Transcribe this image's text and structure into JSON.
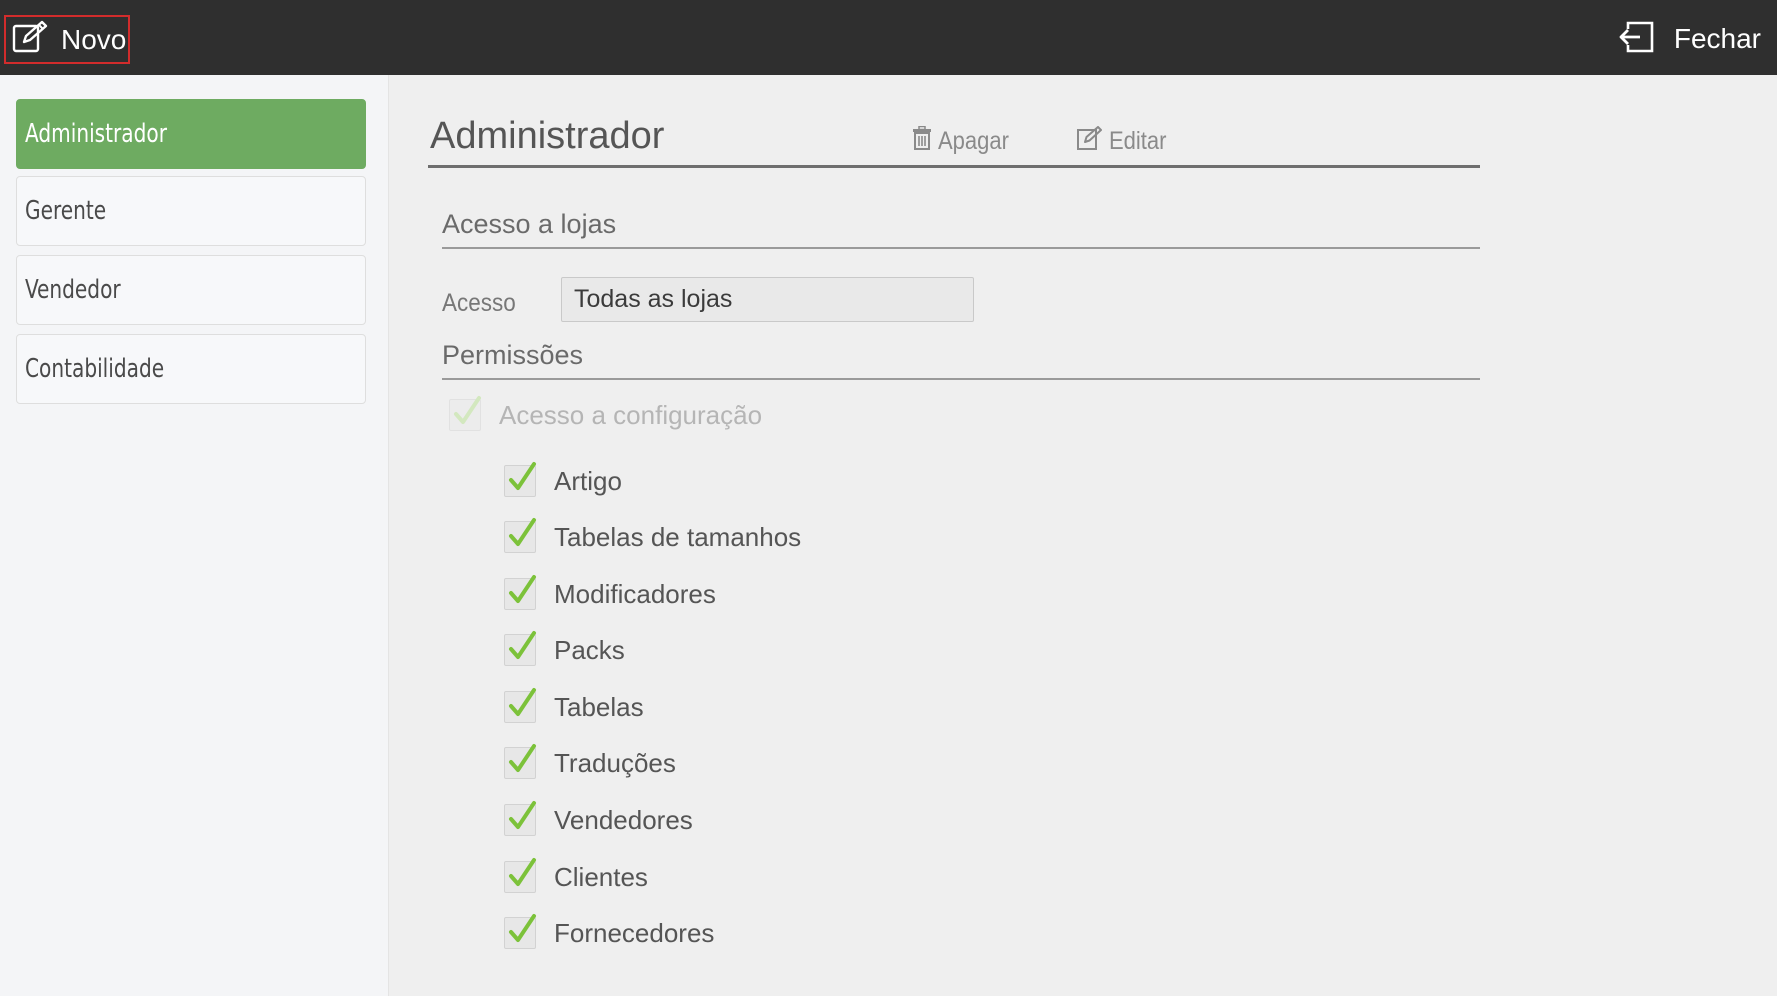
{
  "topbar": {
    "new_label": "Novo",
    "close_label": "Fechar"
  },
  "sidebar": {
    "items": [
      {
        "label": "Administrador",
        "active": true
      },
      {
        "label": "Gerente",
        "active": false
      },
      {
        "label": "Vendedor",
        "active": false
      },
      {
        "label": "Contabilidade",
        "active": false
      }
    ]
  },
  "main": {
    "title": "Administrador",
    "delete_label": "Apagar",
    "edit_label": "Editar",
    "store_access": {
      "section_title": "Acesso a lojas",
      "field_label": "Acesso",
      "value": "Todas as lojas"
    },
    "permissions": {
      "section_title": "Permissões",
      "parent": {
        "label": "Acesso a configuração",
        "checked": true,
        "disabled": true
      },
      "items": [
        {
          "label": "Artigo",
          "checked": true
        },
        {
          "label": "Tabelas de tamanhos",
          "checked": true
        },
        {
          "label": "Modificadores",
          "checked": true
        },
        {
          "label": "Packs",
          "checked": true
        },
        {
          "label": "Tabelas",
          "checked": true
        },
        {
          "label": "Traduções",
          "checked": true
        },
        {
          "label": "Vendedores",
          "checked": true
        },
        {
          "label": "Clientes",
          "checked": true
        },
        {
          "label": "Fornecedores",
          "checked": true
        }
      ]
    }
  },
  "colors": {
    "topbar": "#2f2f2f",
    "active_role": "#6eab61",
    "check": "#7cc23a",
    "check_disabled": "#d3e8bf",
    "highlight_border": "#d22c2c"
  },
  "icons": {
    "new": "edit-note-icon",
    "close": "exit-icon",
    "delete": "trash-icon",
    "edit": "edit-icon",
    "check": "checkmark-icon"
  }
}
